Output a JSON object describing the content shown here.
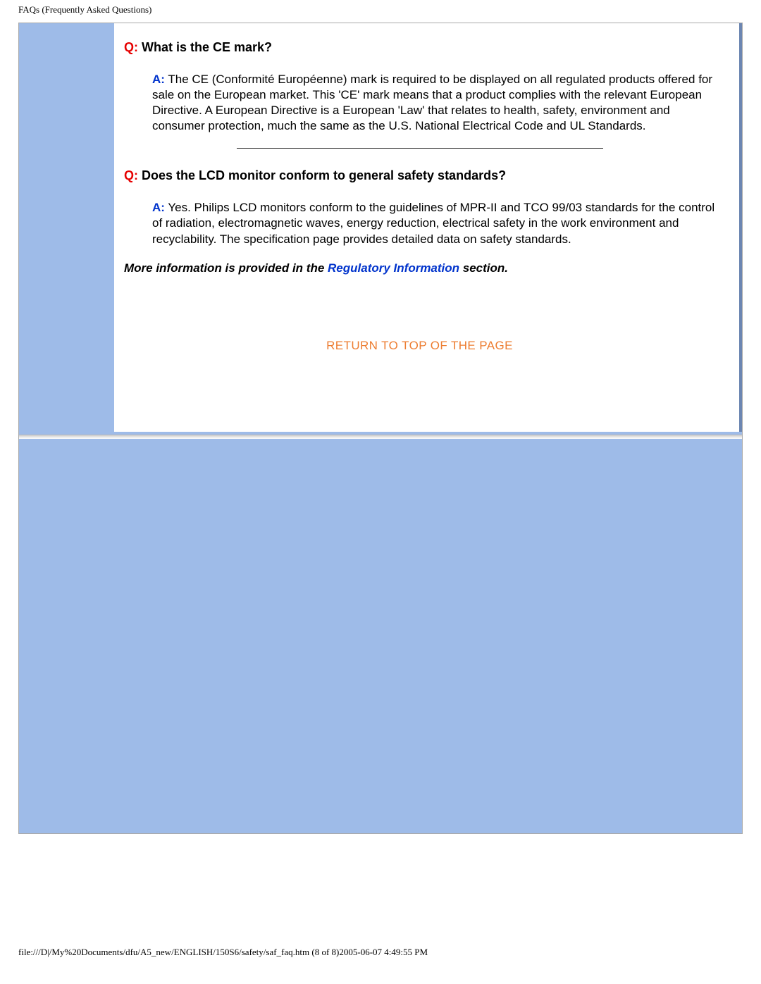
{
  "header": {
    "title": "FAQs (Frequently Asked Questions)"
  },
  "faq": {
    "items": [
      {
        "q_marker": "Q:",
        "question": " What is the CE mark?",
        "a_marker": "A:",
        "answer": " The CE (Conformité Européenne) mark is required to be displayed on all regulated products offered for sale on the European market. This 'CE' mark means that a product complies with the relevant European Directive. A European Directive is a European 'Law' that relates to health, safety, environment and consumer protection, much the same as the U.S. National Electrical Code and UL Standards."
      },
      {
        "q_marker": "Q:",
        "question": " Does the LCD monitor conform to general safety standards?",
        "a_marker": "A:",
        "answer": " Yes. Philips LCD monitors conform to the guidelines of MPR-II and TCO 99/03 standards for the control of radiation, electromagnetic waves, energy reduction, electrical safety in the work environment and recyclability. The specification page provides detailed data on safety standards."
      }
    ],
    "more_info_prefix": "More information is provided in the ",
    "more_info_link": "Regulatory Information",
    "more_info_suffix": " section."
  },
  "return_link": {
    "label": "RETURN TO TOP OF THE PAGE"
  },
  "footer": {
    "path": "file:///D|/My%20Documents/dfu/A5_new/ENGLISH/150S6/safety/saf_faq.htm (8 of 8)2005-06-07 4:49:55 PM"
  }
}
